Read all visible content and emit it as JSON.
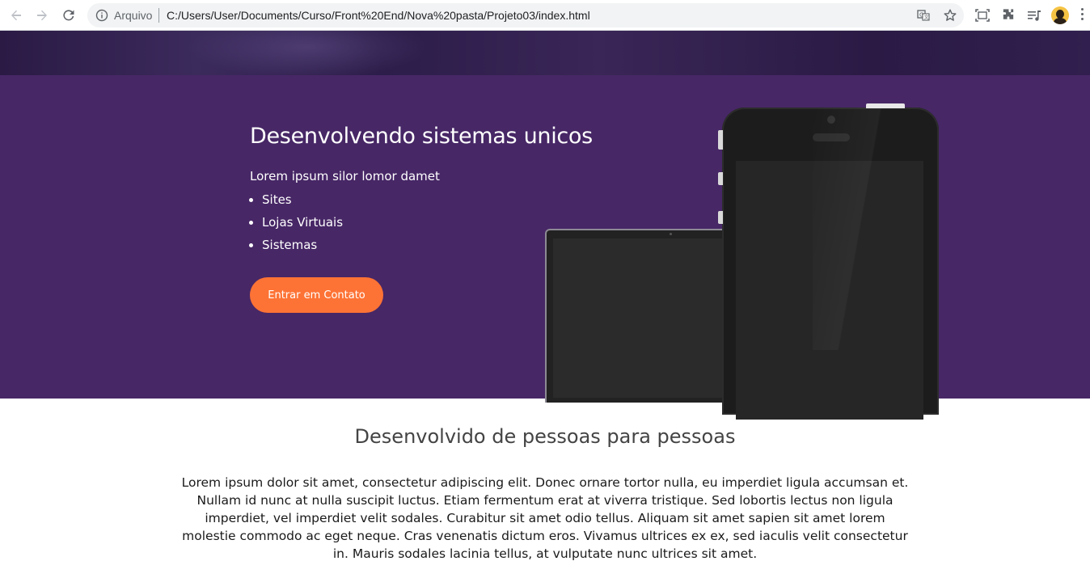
{
  "browser": {
    "scheme_label": "Arquivo",
    "url": "C:/Users/User/Documents/Curso/Front%20End/Nova%20pasta/Projeto03/index.html",
    "icons": [
      "back-icon",
      "forward-icon",
      "reload-icon",
      "info-icon",
      "translate-icon",
      "star-icon",
      "screenshot-icon",
      "extensions-icon",
      "media-icon",
      "avatar",
      "menu-icon"
    ]
  },
  "hero": {
    "title": "Desenvolvendo sistemas unicos",
    "lead": "Lorem ipsum silor lomor damet",
    "list": [
      "Sites",
      "Lojas Virtuais",
      "Sistemas"
    ],
    "cta_label": "Entrar em Contato",
    "colors": {
      "background": "#472766",
      "cta": "#fd7335"
    }
  },
  "about": {
    "title": "Desenvolvido de pessoas para pessoas",
    "text": "Lorem ipsum dolor sit amet, consectetur adipiscing elit. Donec ornare tortor nulla, eu imperdiet ligula accumsan et. Nullam id nunc at nulla suscipit luctus. Etiam fermentum erat at viverra tristique. Sed lobortis lectus non ligula imperdiet, vel imperdiet velit sodales. Curabitur sit amet odio tellus. Aliquam sit amet sapien sit amet lorem molestie commodo ac eget neque. Cras venenatis dictum eros. Vivamus ultrices ex ex, sed iaculis velit consectetur in. Mauris sodales lacinia tellus, at vulputate nunc ultrices sit amet."
  }
}
